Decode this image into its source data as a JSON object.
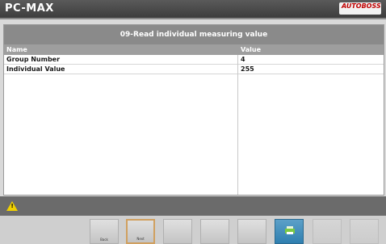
{
  "app": {
    "title": "PC-MAX",
    "brand": "AUTOBOSS",
    "brand_sub": ""
  },
  "screen": {
    "heading": "09-Read individual measuring value"
  },
  "table": {
    "columns": [
      "Name",
      "Value"
    ],
    "rows": [
      {
        "name": "Group Number",
        "value": "4"
      },
      {
        "name": "Individual Value",
        "value": "255"
      }
    ]
  },
  "status": {
    "icon": "warning-icon"
  },
  "toolbar": {
    "buttons": [
      {
        "label": "Back",
        "state": "normal"
      },
      {
        "label": "Next",
        "state": "active"
      },
      {
        "label": "",
        "state": "normal"
      },
      {
        "label": "",
        "state": "normal"
      },
      {
        "label": "",
        "state": "normal"
      },
      {
        "label": "",
        "state": "green"
      },
      {
        "label": "",
        "state": "dim"
      },
      {
        "label": "",
        "state": "dim"
      }
    ]
  },
  "colors": {
    "header_gray": "#8a8a8a",
    "title_bar": "#4a4a4a",
    "brand_red": "#c00000",
    "warning": "#f0d000"
  }
}
